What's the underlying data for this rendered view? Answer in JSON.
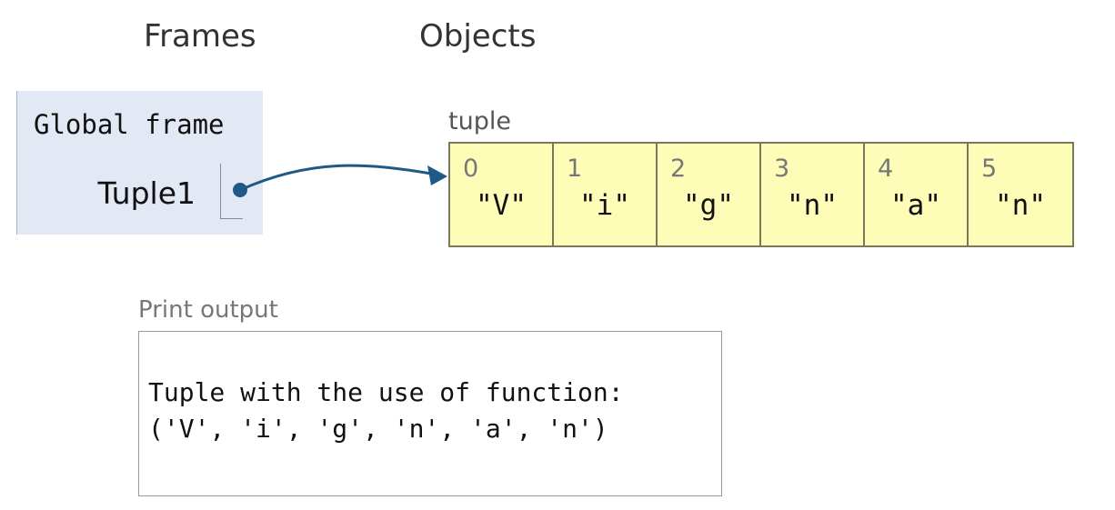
{
  "headings": {
    "frames": "Frames",
    "objects": "Objects"
  },
  "frame": {
    "title": "Global frame",
    "variables": [
      {
        "name": "Tuple1",
        "points_to": "tuple"
      }
    ]
  },
  "object": {
    "type_label": "tuple",
    "elements": [
      {
        "index": "0",
        "value": "\"V\""
      },
      {
        "index": "1",
        "value": "\"i\""
      },
      {
        "index": "2",
        "value": "\"g\""
      },
      {
        "index": "3",
        "value": "\"n\""
      },
      {
        "index": "4",
        "value": "\"a\""
      },
      {
        "index": "5",
        "value": "\"n\""
      }
    ]
  },
  "print_output": {
    "label": "Print output",
    "lines": [
      "Tuple with the use of function:",
      "('V', 'i', 'g', 'n', 'a', 'n')"
    ]
  },
  "colors": {
    "frame_bg": "#e2e8f4",
    "tuple_bg": "#fdfdb8",
    "arrow": "#1f5a86"
  }
}
